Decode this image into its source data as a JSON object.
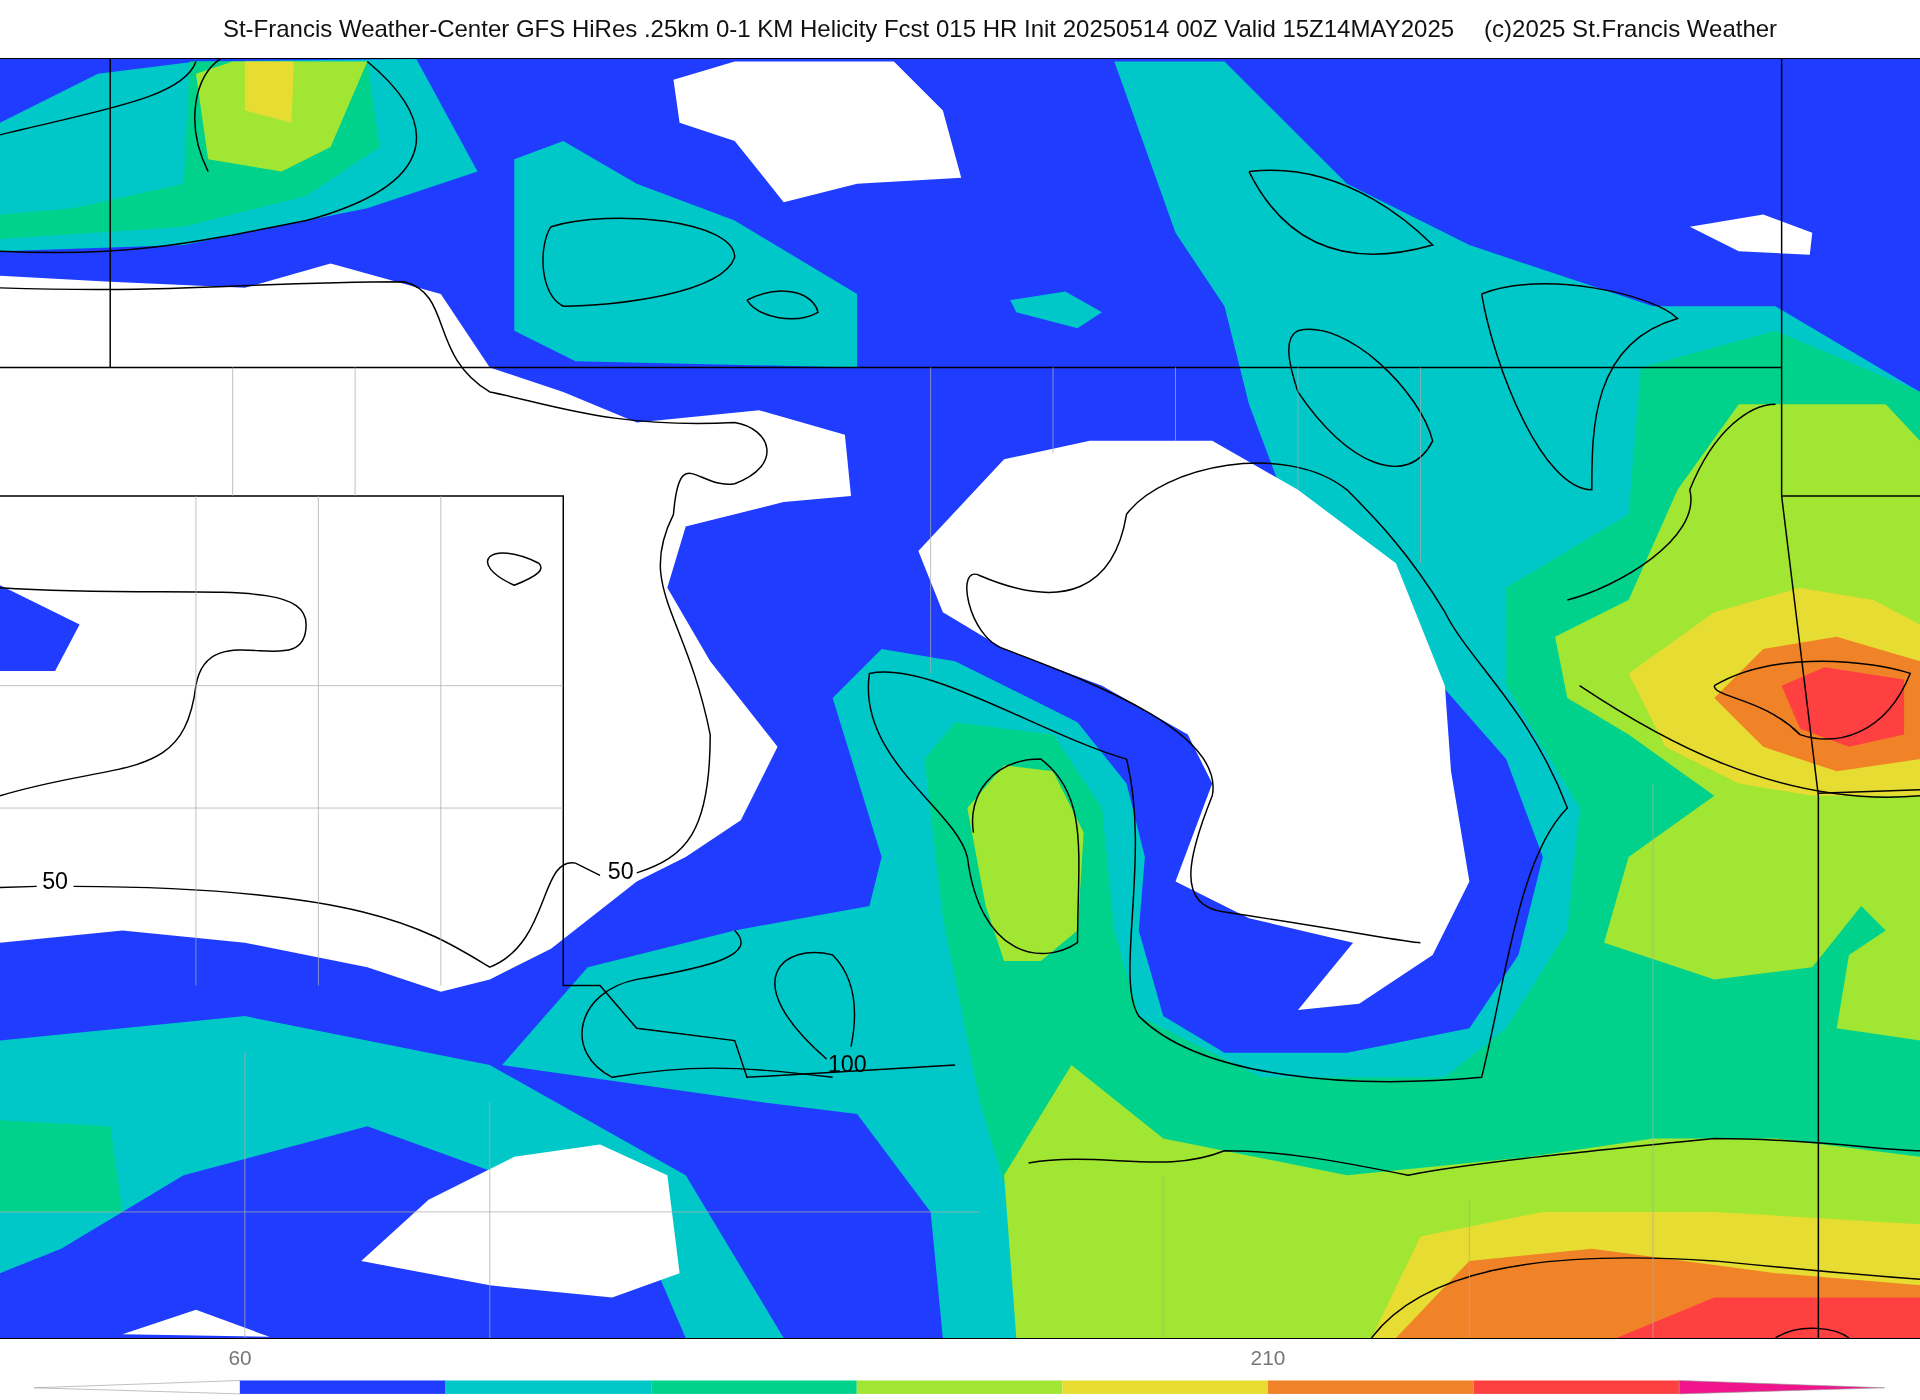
{
  "header": {
    "title": "St-Francis Weather-Center GFS HiRes .25km 0-1 KM Helicity Fcst 015 HR Init 20250514 00Z  Valid 15Z14MAY2025",
    "credit": "(c)2025 St.Francis Weather"
  },
  "map": {
    "contour_labels": [
      "50",
      "50",
      "100"
    ]
  },
  "colorbar": {
    "ticks": [
      {
        "label": "60"
      },
      {
        "label": "210"
      }
    ],
    "bins": [
      {
        "kind": "low-arrow",
        "color": "#ffffff"
      },
      {
        "kind": "bin",
        "color": "#1f3cff"
      },
      {
        "kind": "bin",
        "color": "#00c8c8"
      },
      {
        "kind": "bin",
        "color": "#00d28c"
      },
      {
        "kind": "bin",
        "color": "#a0e632"
      },
      {
        "kind": "bin",
        "color": "#e6dc32"
      },
      {
        "kind": "bin",
        "color": "#f08228"
      },
      {
        "kind": "bin",
        "color": "#ff4040"
      },
      {
        "kind": "high-arrow",
        "color": "#f0148c"
      }
    ]
  }
}
